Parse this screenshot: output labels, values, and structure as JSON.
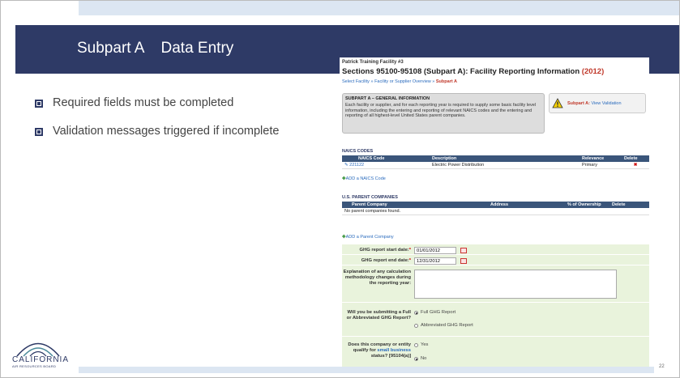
{
  "slide": {
    "title": "Subpart A    Data Entry",
    "page_number": "22",
    "bullets": [
      "Required fields must be completed",
      "Validation messages triggered if incomplete"
    ],
    "logo": {
      "word": "CALIFORNIA",
      "sub": "AIR RESOURCES BOARD"
    }
  },
  "screen": {
    "facility": "Patrick Training Facility #3",
    "title": "Sections 95100-95108 (Subpart A): Facility Reporting Information",
    "year": "(2012)",
    "breadcrumb": {
      "item1": "Select Facility",
      "sep1": " » ",
      "item2": "Facility or Supplier Overview",
      "sep2": " » ",
      "current": "Subpart A"
    },
    "info": {
      "title": "SUBPART A – GENERAL INFORMATION",
      "text": "Each facility or supplier, and for each reporting year is required to supply some basic facility level information, including the entering and reporting of relevant NAICS codes and the entering and reporting of all highest-level United States parent companies."
    },
    "validation": {
      "label": "Subpart A:",
      "link": "View Validation"
    },
    "naics": {
      "heading": "NAICS CODES",
      "columns": [
        "NAICS Code",
        "Description",
        "Relevance",
        "Delete"
      ],
      "rows": [
        {
          "code": "221122",
          "description": "Electric Power Distribution",
          "relevance": "Primary",
          "delete": "✖"
        }
      ],
      "add_label": "ADD a NAICS Code"
    },
    "parents": {
      "heading": "U.S. PARENT COMPANIES",
      "columns": [
        "Parent Company",
        "Address",
        "% of Ownership",
        "Delete"
      ],
      "empty": "No parent companies found.",
      "add_label": "ADD a Parent Company"
    },
    "form": {
      "start_label": "GHG report start date:",
      "start_value": "01/01/2012",
      "end_label": "GHG report end date:",
      "end_value": "12/31/2012",
      "explain_label": "Explanation of any calculation methodology changes during the reporting year:",
      "explain_value": "",
      "submit_label": "Will you be submitting a Full or Abbreviated GHG Report?",
      "submit_options": [
        "Full GHG Report",
        "Abbreviated GHG Report"
      ],
      "submit_selected": "Full GHG Report",
      "small_label_pre": "Does this company or entity qualify for",
      "small_label_link": "small business",
      "small_label_post": "status? [95104(a)]",
      "small_options": [
        "Yes",
        "No"
      ],
      "small_selected": "No"
    }
  }
}
